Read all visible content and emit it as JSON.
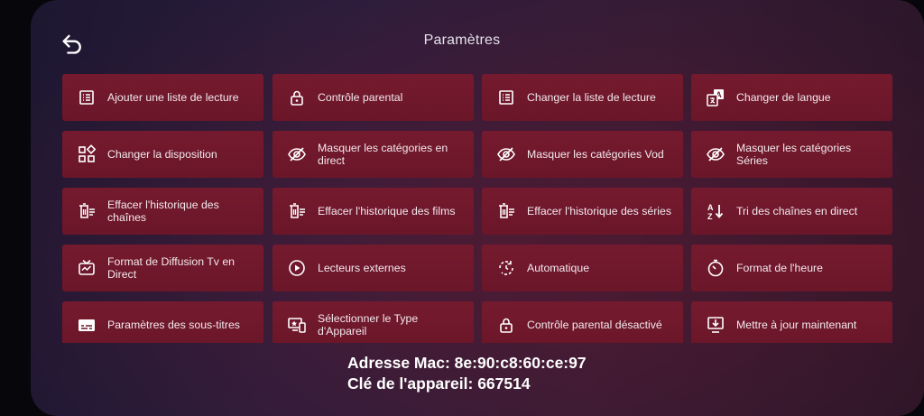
{
  "header": {
    "title": "Paramètres",
    "back_icon": "back-arrow-icon"
  },
  "tiles": [
    {
      "label": "Ajouter une liste de lecture",
      "icon": "list-icon"
    },
    {
      "label": "Contrôle parental",
      "icon": "lock-icon"
    },
    {
      "label": "Changer la liste de lecture",
      "icon": "list-icon"
    },
    {
      "label": "Changer de langue",
      "icon": "translate-icon"
    },
    {
      "label": "Changer la disposition",
      "icon": "layout-icon"
    },
    {
      "label": "Masquer les catégories en direct",
      "icon": "eye-off-icon"
    },
    {
      "label": "Masquer les catégories Vod",
      "icon": "eye-off-icon"
    },
    {
      "label": "Masquer les catégories Séries",
      "icon": "eye-off-icon"
    },
    {
      "label": "Effacer l'historique des chaînes",
      "icon": "clear-history-icon"
    },
    {
      "label": "Effacer l'historique des films",
      "icon": "clear-history-icon"
    },
    {
      "label": "Effacer l'historique des séries",
      "icon": "clear-history-icon"
    },
    {
      "label": "Tri des chaînes en direct",
      "icon": "sort-az-icon"
    },
    {
      "label": "Format de Diffusion Tv en Direct",
      "icon": "live-tv-icon"
    },
    {
      "label": "Lecteurs externes",
      "icon": "play-circle-icon"
    },
    {
      "label": "Automatique",
      "icon": "auto-refresh-icon"
    },
    {
      "label": "Format de l'heure",
      "icon": "timer-icon"
    },
    {
      "label": "Paramètres des sous-titres",
      "icon": "subtitles-icon"
    },
    {
      "label": "Sélectionner le Type d'Appareil",
      "icon": "devices-icon"
    },
    {
      "label": "Contrôle parental désactivé",
      "icon": "lock-icon"
    },
    {
      "label": "Mettre à jour maintenant",
      "icon": "update-icon"
    }
  ],
  "device_info": {
    "mac": "Adresse Mac: 8e:90:c8:60:ce:97",
    "key": "Clé de l'appareil: 667514"
  },
  "colors": {
    "tile": "#701a2c",
    "background": "#2a1d3d",
    "text": "#f2e9ec"
  }
}
